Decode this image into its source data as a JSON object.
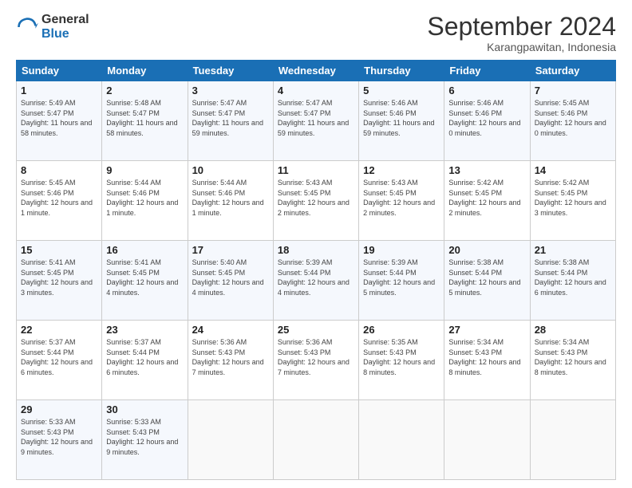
{
  "header": {
    "logo_general": "General",
    "logo_blue": "Blue",
    "month_title": "September 2024",
    "location": "Karangpawitan, Indonesia"
  },
  "weekdays": [
    "Sunday",
    "Monday",
    "Tuesday",
    "Wednesday",
    "Thursday",
    "Friday",
    "Saturday"
  ],
  "weeks": [
    [
      {
        "day": "1",
        "sunrise": "5:49 AM",
        "sunset": "5:47 PM",
        "daylight": "11 hours and 58 minutes."
      },
      {
        "day": "2",
        "sunrise": "5:48 AM",
        "sunset": "5:47 PM",
        "daylight": "11 hours and 58 minutes."
      },
      {
        "day": "3",
        "sunrise": "5:47 AM",
        "sunset": "5:47 PM",
        "daylight": "11 hours and 59 minutes."
      },
      {
        "day": "4",
        "sunrise": "5:47 AM",
        "sunset": "5:47 PM",
        "daylight": "11 hours and 59 minutes."
      },
      {
        "day": "5",
        "sunrise": "5:46 AM",
        "sunset": "5:46 PM",
        "daylight": "11 hours and 59 minutes."
      },
      {
        "day": "6",
        "sunrise": "5:46 AM",
        "sunset": "5:46 PM",
        "daylight": "12 hours and 0 minutes."
      },
      {
        "day": "7",
        "sunrise": "5:45 AM",
        "sunset": "5:46 PM",
        "daylight": "12 hours and 0 minutes."
      }
    ],
    [
      {
        "day": "8",
        "sunrise": "5:45 AM",
        "sunset": "5:46 PM",
        "daylight": "12 hours and 1 minute."
      },
      {
        "day": "9",
        "sunrise": "5:44 AM",
        "sunset": "5:46 PM",
        "daylight": "12 hours and 1 minute."
      },
      {
        "day": "10",
        "sunrise": "5:44 AM",
        "sunset": "5:46 PM",
        "daylight": "12 hours and 1 minute."
      },
      {
        "day": "11",
        "sunrise": "5:43 AM",
        "sunset": "5:45 PM",
        "daylight": "12 hours and 2 minutes."
      },
      {
        "day": "12",
        "sunrise": "5:43 AM",
        "sunset": "5:45 PM",
        "daylight": "12 hours and 2 minutes."
      },
      {
        "day": "13",
        "sunrise": "5:42 AM",
        "sunset": "5:45 PM",
        "daylight": "12 hours and 2 minutes."
      },
      {
        "day": "14",
        "sunrise": "5:42 AM",
        "sunset": "5:45 PM",
        "daylight": "12 hours and 3 minutes."
      }
    ],
    [
      {
        "day": "15",
        "sunrise": "5:41 AM",
        "sunset": "5:45 PM",
        "daylight": "12 hours and 3 minutes."
      },
      {
        "day": "16",
        "sunrise": "5:41 AM",
        "sunset": "5:45 PM",
        "daylight": "12 hours and 4 minutes."
      },
      {
        "day": "17",
        "sunrise": "5:40 AM",
        "sunset": "5:45 PM",
        "daylight": "12 hours and 4 minutes."
      },
      {
        "day": "18",
        "sunrise": "5:39 AM",
        "sunset": "5:44 PM",
        "daylight": "12 hours and 4 minutes."
      },
      {
        "day": "19",
        "sunrise": "5:39 AM",
        "sunset": "5:44 PM",
        "daylight": "12 hours and 5 minutes."
      },
      {
        "day": "20",
        "sunrise": "5:38 AM",
        "sunset": "5:44 PM",
        "daylight": "12 hours and 5 minutes."
      },
      {
        "day": "21",
        "sunrise": "5:38 AM",
        "sunset": "5:44 PM",
        "daylight": "12 hours and 6 minutes."
      }
    ],
    [
      {
        "day": "22",
        "sunrise": "5:37 AM",
        "sunset": "5:44 PM",
        "daylight": "12 hours and 6 minutes."
      },
      {
        "day": "23",
        "sunrise": "5:37 AM",
        "sunset": "5:44 PM",
        "daylight": "12 hours and 6 minutes."
      },
      {
        "day": "24",
        "sunrise": "5:36 AM",
        "sunset": "5:43 PM",
        "daylight": "12 hours and 7 minutes."
      },
      {
        "day": "25",
        "sunrise": "5:36 AM",
        "sunset": "5:43 PM",
        "daylight": "12 hours and 7 minutes."
      },
      {
        "day": "26",
        "sunrise": "5:35 AM",
        "sunset": "5:43 PM",
        "daylight": "12 hours and 8 minutes."
      },
      {
        "day": "27",
        "sunrise": "5:34 AM",
        "sunset": "5:43 PM",
        "daylight": "12 hours and 8 minutes."
      },
      {
        "day": "28",
        "sunrise": "5:34 AM",
        "sunset": "5:43 PM",
        "daylight": "12 hours and 8 minutes."
      }
    ],
    [
      {
        "day": "29",
        "sunrise": "5:33 AM",
        "sunset": "5:43 PM",
        "daylight": "12 hours and 9 minutes."
      },
      {
        "day": "30",
        "sunrise": "5:33 AM",
        "sunset": "5:43 PM",
        "daylight": "12 hours and 9 minutes."
      },
      null,
      null,
      null,
      null,
      null
    ]
  ]
}
